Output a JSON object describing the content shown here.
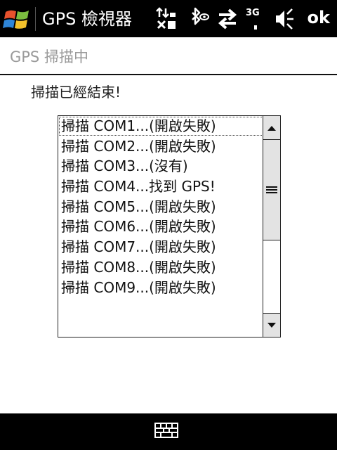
{
  "titlebar": {
    "app_title": "GPS 檢視器",
    "ok_label": "ok",
    "icons": [
      "windows-start-icon",
      "network-transfer-icon",
      "bluetooth-icon",
      "sync-arrows-icon",
      "3g-signal-icon",
      "volume-mute-icon"
    ]
  },
  "header": {
    "title": "GPS 掃描中"
  },
  "scan": {
    "status": "掃描已經結束!",
    "results": [
      "掃描 COM1...(開啟失敗)",
      "掃描 COM2...(開啟失敗)",
      "掃描 COM3...(沒有)",
      "掃描 COM4...找到 GPS!",
      "掃描 COM5...(開啟失敗)",
      "掃描 COM6...(開啟失敗)",
      "掃描 COM7...(開啟失敗)",
      "掃描 COM8...(開啟失敗)",
      "掃描 COM9...(開啟失敗)"
    ]
  },
  "status_icons": {
    "network_label": "3G"
  },
  "colors": {
    "chrome": "#000000",
    "content_bg": "#ffffff",
    "header_text": "#9a9a9a"
  }
}
